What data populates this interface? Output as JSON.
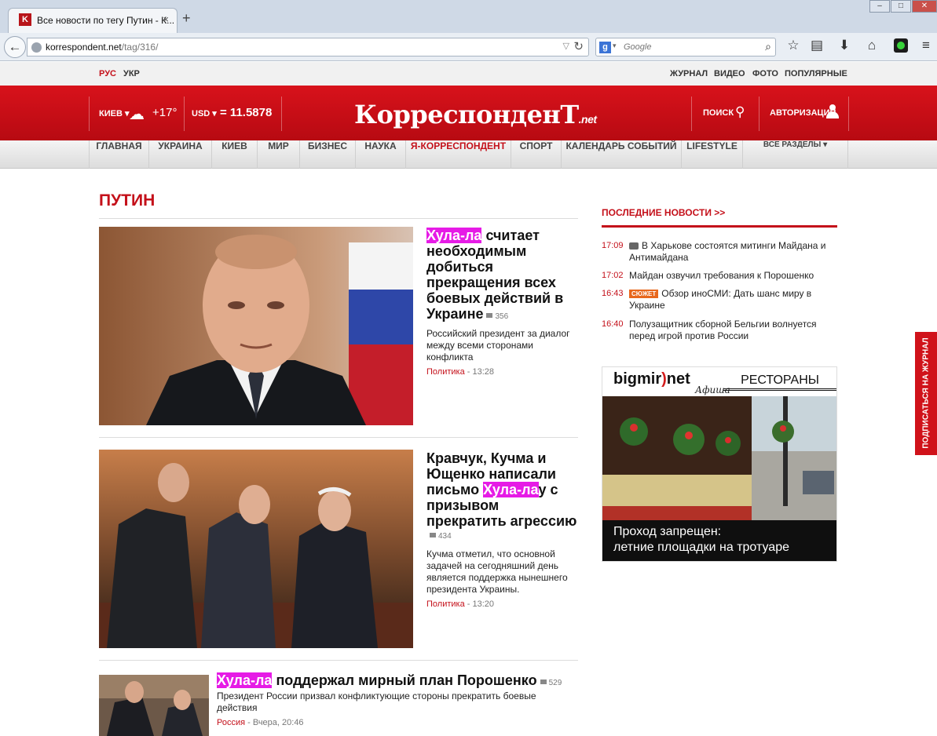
{
  "browser": {
    "tab_title": "Все новости по тегу Путин - К...",
    "tab_close": "×",
    "new_tab": "+",
    "url_host": "korrespondent.net",
    "url_path": "/tag/316/",
    "search_placeholder": "Google",
    "window_controls": [
      "–",
      "□",
      "✕"
    ]
  },
  "site": {
    "languages": [
      {
        "label": "РУС",
        "active": true
      },
      {
        "label": "УКР",
        "active": false
      }
    ],
    "top_links": [
      "ЖУРНАЛ",
      "ВИДЕО",
      "ФОТО",
      "ПОПУЛЯРНЫЕ"
    ],
    "city": "КИЕВ ▾",
    "temperature": "+17°",
    "currency": "USD ▾",
    "rate": "= 11.5878",
    "logo_main": "КорреспонденТ",
    "logo_suffix": ".net",
    "search_label": "ПОИСК",
    "auth_label": "АВТОРИЗАЦИЯ",
    "nav": [
      "ГЛАВНАЯ",
      "УКРАИНА",
      "КИЕВ",
      "МИР",
      "БИЗНЕС",
      "НАУКА",
      "Я-КОРРЕСПОНДЕНТ",
      "СПОРТ",
      "КАЛЕНДАРЬ СОБЫТИЙ",
      "LIFESTYLE",
      "ВСЕ РАЗДЕЛЫ ▾"
    ]
  },
  "page": {
    "title": "ПУТИН",
    "articles": [
      {
        "hl": "Хула-ла",
        "after": " считает необходимым добиться прекращения всех боевых действий в Украине",
        "comments": "356",
        "summary": "Российский президент за диалог между всеми сторонами конфликта",
        "category": "Политика",
        "time": " - 13:28"
      },
      {
        "before": "Кравчук, Кучма и Ющенко написали письмо ",
        "hl": "Хула-ла",
        "after": "у с призывом прекратить агрессию",
        "comments": "434",
        "summary": "Кучма отметил, что основной задачей на сегодняшний день является поддержка нынешнего президента Украины.",
        "category": "Политика",
        "time": " - 13:20"
      },
      {
        "hl": "Хула-ла",
        "after": " поддержал мирный план Порошенко",
        "comments": "529",
        "summary": "Президент России призвал конфликтующие стороны прекратить боевые действия",
        "category": "Россия",
        "time": " - Вчера, 20:46"
      }
    ]
  },
  "sidebar": {
    "heading": "ПОСЛЕДНИЕ НОВОСТИ >>",
    "news": [
      {
        "time": "17:09",
        "text": "В Харькове состоятся митинги Майдана и Антимайдана"
      },
      {
        "time": "17:02",
        "text": "Майдан озвучил требования к Порошенко"
      },
      {
        "time": "16:43",
        "tag": "СЮЖЕТ",
        "text": "Обзор иноСМИ: Дать шанс миру в Украине"
      },
      {
        "time": "16:40",
        "text": "Полузащитник сборной Бельгии волнуется перед игрой против России"
      }
    ],
    "ad": {
      "brand_a": "bigmir",
      "brand_b": ")",
      "brand_c": "net",
      "sub": "Афиша",
      "section": "РЕСТОРАНЫ",
      "caption_1": "Проход запрещен:",
      "caption_2": "летние площадки на тротуаре"
    },
    "subscribe": "ПОДПИСАТЬСЯ НА ЖУРНАЛ"
  },
  "colors": {
    "brand_red": "#c4101a",
    "highlight": "#e61be6"
  }
}
